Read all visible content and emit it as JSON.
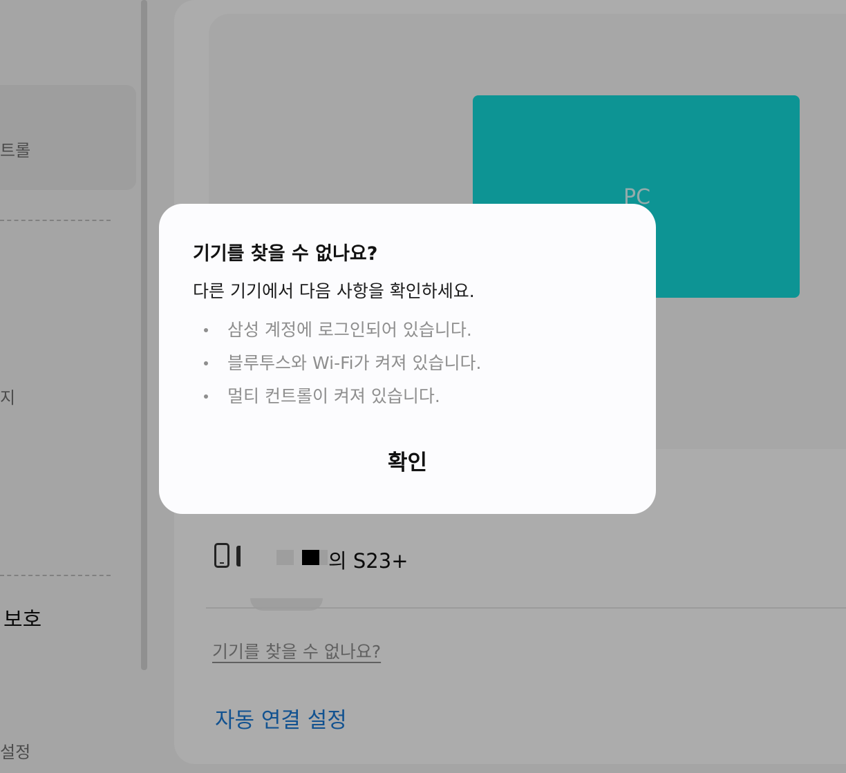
{
  "sidebar": {
    "items": [
      {
        "label": "트롤"
      },
      {
        "label": "지"
      },
      {
        "label": "보호"
      },
      {
        "label": "설정"
      }
    ]
  },
  "main": {
    "pc_label": "PC",
    "device": {
      "name_suffix": "의 S23+"
    },
    "cant_find_link": "기기를 찾을 수 없나요?",
    "auto_connect_link": "자동 연결 설정"
  },
  "dialog": {
    "title": "기기를 찾을 수 없나요?",
    "subtitle": "다른 기기에서 다음 사항을 확인하세요.",
    "checklist": [
      "삼성 계정에 로그인되어 있습니다.",
      "블루투스와 Wi-Fi가 켜져 있습니다.",
      "멀티 컨트롤이 켜져 있습니다."
    ],
    "ok_label": "확인"
  },
  "colors": {
    "accent_teal": "#14d5d4",
    "link_blue": "#1a76cf",
    "overlay": "rgba(0,0,0,0.30)"
  }
}
